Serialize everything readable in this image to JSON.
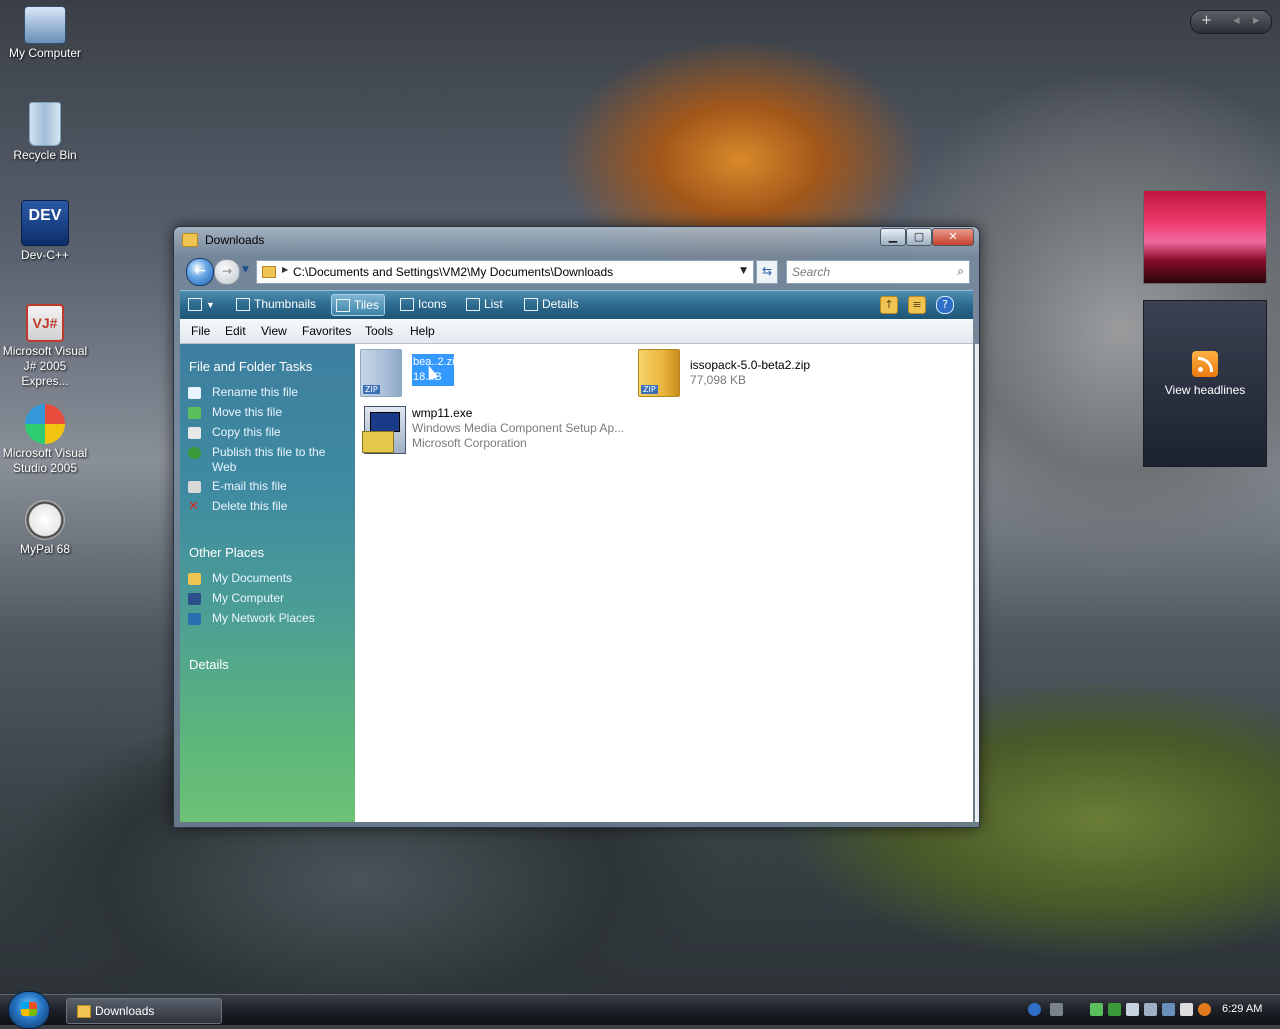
{
  "desktop": {
    "icons": [
      {
        "label": "My Computer",
        "icon": "computer-icon"
      },
      {
        "label": "Recycle Bin",
        "icon": "recycle-bin-icon"
      },
      {
        "label": "Dev-C++",
        "icon": "devcpp-icon"
      },
      {
        "label": "Microsoft Visual J# 2005 Expres...",
        "icon": "visual-jsharp-icon"
      },
      {
        "label": "Microsoft Visual Studio 2005",
        "icon": "visual-studio-icon"
      },
      {
        "label": "MyPal 68",
        "icon": "mypal-icon"
      }
    ]
  },
  "sidebar_gadgets": {
    "feed_label": "View headlines",
    "controls": {
      "add": "+",
      "prev": "◂",
      "next": "▸"
    }
  },
  "window": {
    "title": "Downloads",
    "buttons": {
      "minimize": "▁",
      "maximize": "▢",
      "close": "✕"
    },
    "address": {
      "path": "C:\\Documents and Settings\\VM2\\My Documents\\Downloads",
      "search_placeholder": "Search"
    },
    "toolbar": {
      "views": [
        {
          "label": "Thumbnails",
          "active": false
        },
        {
          "label": "Tiles",
          "active": true
        },
        {
          "label": "Icons",
          "active": false
        },
        {
          "label": "List",
          "active": false
        },
        {
          "label": "Details",
          "active": false
        }
      ]
    },
    "menu": [
      "File",
      "Edit",
      "View",
      "Favorites",
      "Tools",
      "Help"
    ],
    "tasks_panel": {
      "file_tasks_header": "File and Folder Tasks",
      "file_tasks": [
        {
          "label": "Rename this file",
          "icon": "rename-icon",
          "color": "#e8f4ff"
        },
        {
          "label": "Move this file",
          "icon": "move-icon",
          "color": "#5bc05b"
        },
        {
          "label": "Copy this file",
          "icon": "copy-icon",
          "color": "#e8e8e8"
        },
        {
          "label": "Publish this file to the Web",
          "icon": "globe-icon",
          "color": "#3a9a3a"
        },
        {
          "label": "E-mail this file",
          "icon": "email-icon",
          "color": "#d8d8d8"
        },
        {
          "label": "Delete this file",
          "icon": "delete-icon",
          "color": "#d42a1e"
        }
      ],
      "other_places_header": "Other Places",
      "other_places": [
        {
          "label": "My Documents",
          "icon": "folder-icon",
          "color": "#f0c453"
        },
        {
          "label": "My Computer",
          "icon": "computer-icon",
          "color": "#2a4f8a"
        },
        {
          "label": "My Network Places",
          "icon": "network-icon",
          "color": "#2a6fb0"
        }
      ],
      "details_header": "Details"
    },
    "files": [
      {
        "name": "bea..2.zip",
        "sub": "18...B",
        "type": "zip",
        "selected": true
      },
      {
        "name": "issopack-5.0-beta2.zip",
        "sub": "77,098 KB",
        "type": "zip",
        "selected": false
      },
      {
        "name": "wmp11.exe",
        "sub": "Windows Media Component Setup Ap...",
        "sub2": "Microsoft Corporation",
        "type": "exe",
        "selected": false
      }
    ]
  },
  "taskbar": {
    "task_button": "Downloads",
    "clock": "6:29 AM"
  },
  "colors": {
    "accent": "#2c6a8f",
    "selection": "#3399ff"
  }
}
